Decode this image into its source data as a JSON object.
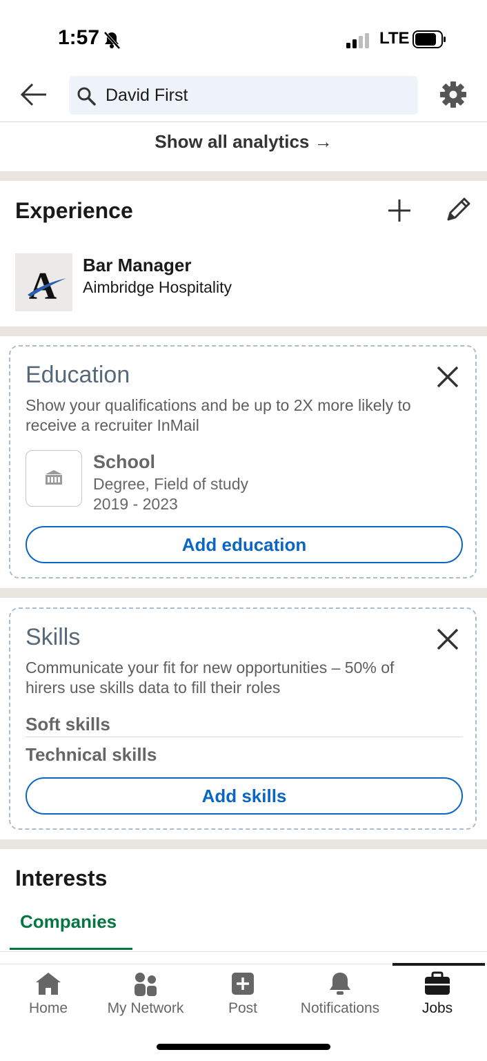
{
  "status_bar": {
    "time": "1:57",
    "network": "LTE"
  },
  "search": {
    "value": "David First"
  },
  "analytics_link": "Show all analytics →",
  "experience": {
    "title": "Experience",
    "item": {
      "role": "Bar Manager",
      "company": "Aimbridge Hospitality",
      "logo_letter": "A"
    }
  },
  "education": {
    "title": "Education",
    "description": "Show your qualifications and be up to 2X more likely to receive a recruiter InMail",
    "school": "School",
    "degree": "Degree, Field of study",
    "years": "2019 - 2023",
    "button": "Add education"
  },
  "skills": {
    "title": "Skills",
    "description": "Communicate your fit for new opportunities – 50% of hirers use skills data to fill their roles",
    "items": [
      "Soft skills",
      "Technical skills"
    ],
    "button": "Add skills"
  },
  "interests": {
    "title": "Interests",
    "tabs": [
      "Companies"
    ]
  },
  "bottom_nav": {
    "items": [
      {
        "label": "Home",
        "icon": "home-icon"
      },
      {
        "label": "My Network",
        "icon": "network-icon"
      },
      {
        "label": "Post",
        "icon": "post-icon"
      },
      {
        "label": "Notifications",
        "icon": "bell-icon"
      },
      {
        "label": "Jobs",
        "icon": "briefcase-icon"
      }
    ],
    "active": "Jobs"
  },
  "colors": {
    "accent": "#0a66c2",
    "green": "#057642",
    "band": "#e9e5df",
    "card_title": "#56687a"
  }
}
